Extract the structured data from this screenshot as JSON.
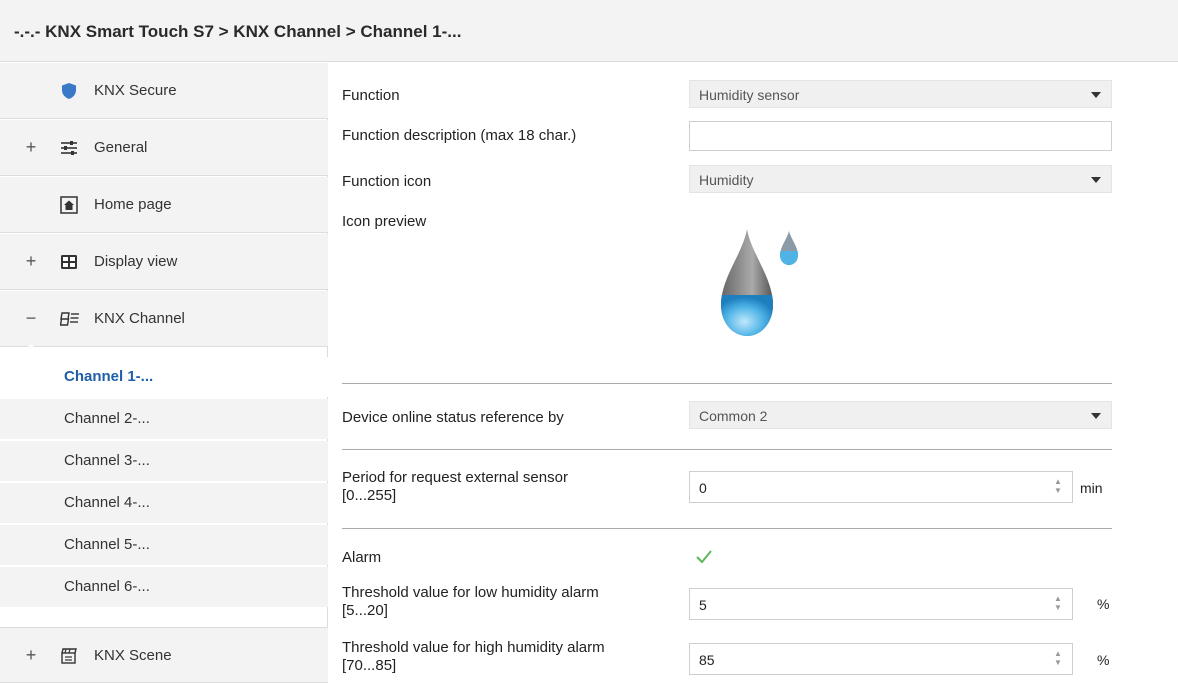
{
  "breadcrumb": "-.-.- KNX Smart Touch S7 > KNX Channel  > Channel 1-...",
  "sidebar": {
    "items": [
      {
        "label": "KNX Secure",
        "icon": "shield-icon",
        "toggle": ""
      },
      {
        "label": "General",
        "icon": "sliders-icon",
        "toggle": "+"
      },
      {
        "label": "Home page",
        "icon": "home-icon",
        "toggle": ""
      },
      {
        "label": "Display view",
        "icon": "display-view-icon",
        "toggle": "+"
      },
      {
        "label": "KNX Channel",
        "icon": "channel-icon",
        "toggle": "−"
      }
    ],
    "channels": [
      "Channel 1-...",
      "Channel 2-...",
      "Channel 3-...",
      "Channel 4-...",
      "Channel 5-...",
      "Channel 6-..."
    ],
    "active_channel": "Channel 1-...",
    "scene": {
      "label": "KNX Scene",
      "icon": "scene-icon",
      "toggle": "+"
    }
  },
  "form": {
    "function_label": "Function",
    "function_value": "Humidity sensor",
    "description_label": "Function description (max 18 char.)",
    "description_value": "",
    "icon_label": "Function icon",
    "icon_value": "Humidity",
    "preview_label": "Icon preview",
    "online_label": "Device online status reference by",
    "online_value": "Common 2",
    "period_label_1": "Period for request external sensor",
    "period_label_2": "[0...255]",
    "period_value": "0",
    "period_unit": "min",
    "alarm_label": "Alarm",
    "alarm_checked": true,
    "low_label_1": "Threshold value for low humidity alarm",
    "low_label_2": "[5...20]",
    "low_value": "5",
    "low_unit": "%",
    "high_label_1": "Threshold value for high humidity alarm",
    "high_label_2": "[70...85]",
    "high_value": "85",
    "high_unit": "%"
  },
  "colors": {
    "active_channel": "#1f5fa8",
    "shield": "#3a78c8",
    "check": "#5cb85c",
    "drop": "#4fb3e6"
  }
}
